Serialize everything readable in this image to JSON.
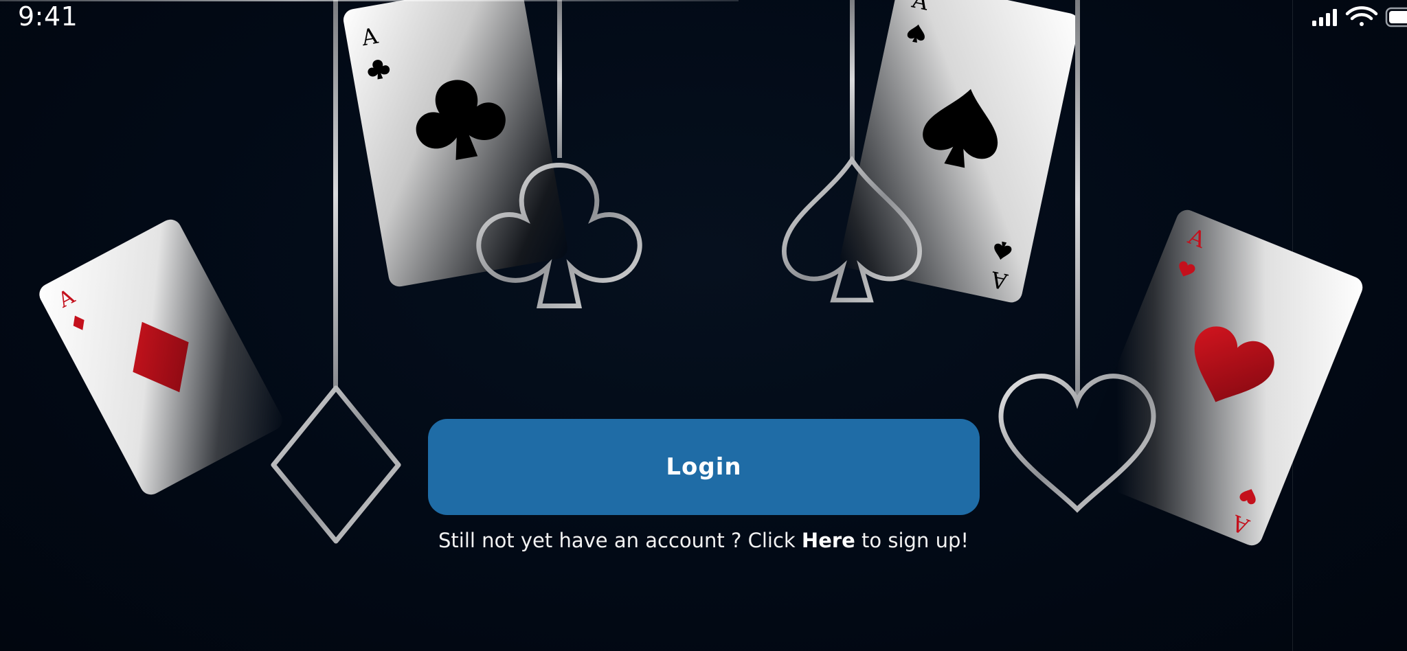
{
  "status_bar": {
    "time": "9:41",
    "icons": [
      "cellular-signal-icon",
      "wifi-icon",
      "battery-icon"
    ]
  },
  "hero_art": {
    "cards": [
      {
        "rank": "A",
        "suit": "diamond",
        "color": "#c4101c"
      },
      {
        "rank": "A",
        "suit": "club",
        "color": "#000000"
      },
      {
        "rank": "A",
        "suit": "spade",
        "color": "#000000"
      },
      {
        "rank": "A",
        "suit": "heart",
        "color": "#c4101c"
      }
    ],
    "hanging_suits": [
      "diamond",
      "club",
      "spade",
      "heart"
    ]
  },
  "login": {
    "button_label": "Login",
    "color": "#1f6ca6"
  },
  "signup": {
    "prefix": "Still not yet have an account ? Click ",
    "link": "Here",
    "suffix": " to sign up!"
  }
}
